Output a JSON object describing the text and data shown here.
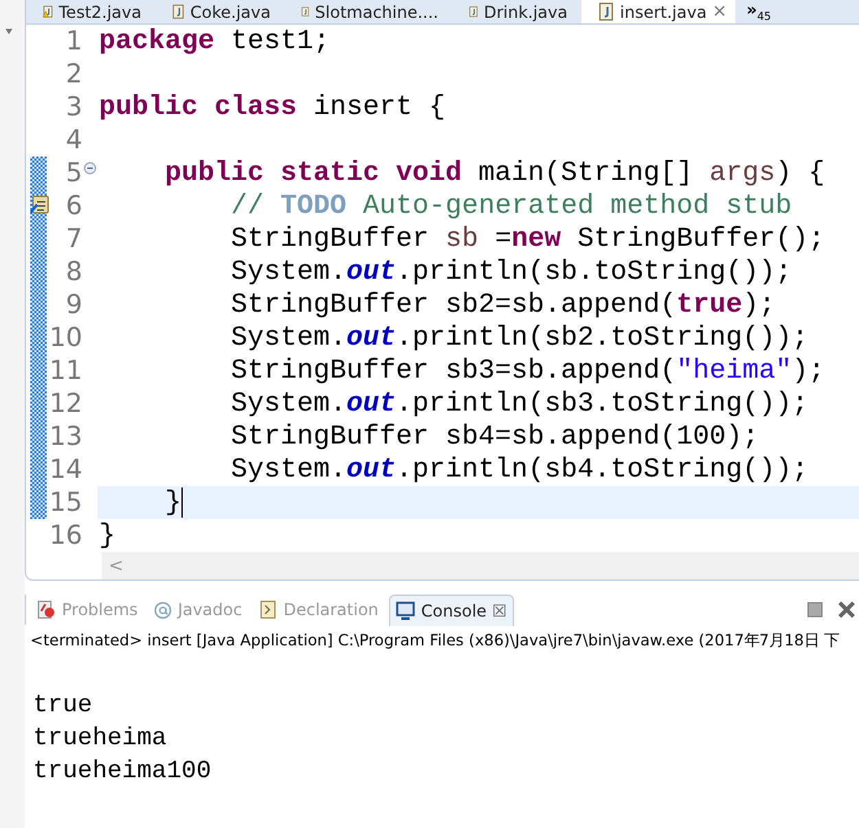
{
  "editor_tabs": [
    {
      "label": "Test2.java",
      "selected": false,
      "warning": true
    },
    {
      "label": "Coke.java",
      "selected": false,
      "warning": false
    },
    {
      "label": "Slotmachine....",
      "selected": false,
      "warning": false
    },
    {
      "label": "Drink.java",
      "selected": false,
      "warning": false
    },
    {
      "label": "insert.java",
      "selected": true,
      "warning": false
    }
  ],
  "tab_close": "×",
  "overflow": {
    "symbol": "»",
    "count": "45"
  },
  "code_lines": [
    {
      "number": "1",
      "changed": false,
      "current": false,
      "foldable": false,
      "task": false,
      "tokens": [
        {
          "kind": "kw",
          "text": "package"
        },
        {
          "kind": "plain",
          "text": " test1;"
        }
      ]
    },
    {
      "number": "2",
      "changed": false,
      "current": false,
      "foldable": false,
      "task": false
    },
    {
      "number": "3",
      "changed": false,
      "current": false,
      "foldable": false,
      "task": false,
      "tokens": [
        {
          "kind": "kw",
          "text": "public class"
        },
        {
          "kind": "plain",
          "text": " insert {"
        }
      ]
    },
    {
      "number": "4",
      "changed": false,
      "current": false,
      "foldable": false,
      "task": false
    },
    {
      "number": "5",
      "changed": true,
      "current": false,
      "foldable": true,
      "task": false,
      "tokens": [
        {
          "kind": "kw",
          "text": "    public static void"
        },
        {
          "kind": "plain",
          "text": " main(String[] "
        },
        {
          "kind": "param",
          "text": "args"
        },
        {
          "kind": "plain",
          "text": ") {"
        }
      ]
    },
    {
      "number": "6",
      "changed": true,
      "current": false,
      "foldable": false,
      "task": true,
      "tokens": [
        {
          "kind": "comment",
          "text": "        // "
        },
        {
          "kind": "todo",
          "text": "TODO"
        },
        {
          "kind": "comment",
          "text": " Auto-generated method stub"
        }
      ]
    },
    {
      "number": "7",
      "changed": true,
      "current": false,
      "foldable": false,
      "task": false,
      "tokens": [
        {
          "kind": "plain",
          "text": "        StringBuffer "
        },
        {
          "kind": "var",
          "text": "sb"
        },
        {
          "kind": "plain",
          "text": " ="
        },
        {
          "kind": "kw",
          "text": "new"
        },
        {
          "kind": "plain",
          "text": " StringBuffer();"
        }
      ]
    },
    {
      "number": "8",
      "changed": true,
      "current": false,
      "foldable": false,
      "task": false,
      "tokens": [
        {
          "kind": "plain",
          "text": "        System."
        },
        {
          "kind": "field",
          "text": "out"
        },
        {
          "kind": "plain",
          "text": ".println(sb.toString());"
        }
      ]
    },
    {
      "number": "9",
      "changed": true,
      "current": false,
      "foldable": false,
      "task": false,
      "tokens": [
        {
          "kind": "plain",
          "text": "        StringBuffer sb2=sb.append("
        },
        {
          "kind": "kw",
          "text": "true"
        },
        {
          "kind": "plain",
          "text": ");"
        }
      ]
    },
    {
      "number": "10",
      "changed": true,
      "current": false,
      "foldable": false,
      "task": false,
      "tokens": [
        {
          "kind": "plain",
          "text": "        System."
        },
        {
          "kind": "field",
          "text": "out"
        },
        {
          "kind": "plain",
          "text": ".println(sb2.toString());"
        }
      ]
    },
    {
      "number": "11",
      "changed": true,
      "current": false,
      "foldable": false,
      "task": false,
      "tokens": [
        {
          "kind": "plain",
          "text": "        StringBuffer sb3=sb.append("
        },
        {
          "kind": "string",
          "text": "\"heima\""
        },
        {
          "kind": "plain",
          "text": ");"
        }
      ]
    },
    {
      "number": "12",
      "changed": true,
      "current": false,
      "foldable": false,
      "task": false,
      "tokens": [
        {
          "kind": "plain",
          "text": "        System."
        },
        {
          "kind": "field",
          "text": "out"
        },
        {
          "kind": "plain",
          "text": ".println(sb3.toString());"
        }
      ]
    },
    {
      "number": "13",
      "changed": true,
      "current": false,
      "foldable": false,
      "task": false,
      "tokens": [
        {
          "kind": "plain",
          "text": "        StringBuffer sb4=sb.append(100);"
        }
      ]
    },
    {
      "number": "14",
      "changed": true,
      "current": false,
      "foldable": false,
      "task": false,
      "tokens": [
        {
          "kind": "plain",
          "text": "        System."
        },
        {
          "kind": "field",
          "text": "out"
        },
        {
          "kind": "plain",
          "text": ".println(sb4.toString());"
        }
      ]
    },
    {
      "number": "15",
      "changed": true,
      "current": true,
      "foldable": false,
      "task": false,
      "tokens": [
        {
          "kind": "plain",
          "text": "    }"
        }
      ]
    },
    {
      "number": "16",
      "changed": false,
      "current": false,
      "foldable": false,
      "task": false,
      "tokens": [
        {
          "kind": "plain",
          "text": "}"
        }
      ]
    }
  ],
  "scroll_left": "<",
  "panel_tabs": [
    {
      "label": "Problems",
      "selected": false
    },
    {
      "label": "Javadoc",
      "selected": false
    },
    {
      "label": "Declaration",
      "selected": false
    },
    {
      "label": "Console",
      "selected": true
    }
  ],
  "panel_tab_close": "☒",
  "console": {
    "status": "<terminated> insert [Java Application] C:\\Program Files (x86)\\Java\\jre7\\bin\\javaw.exe (2017年7月18日 下",
    "output": [
      "true",
      "trueheima",
      "trueheima100"
    ]
  }
}
